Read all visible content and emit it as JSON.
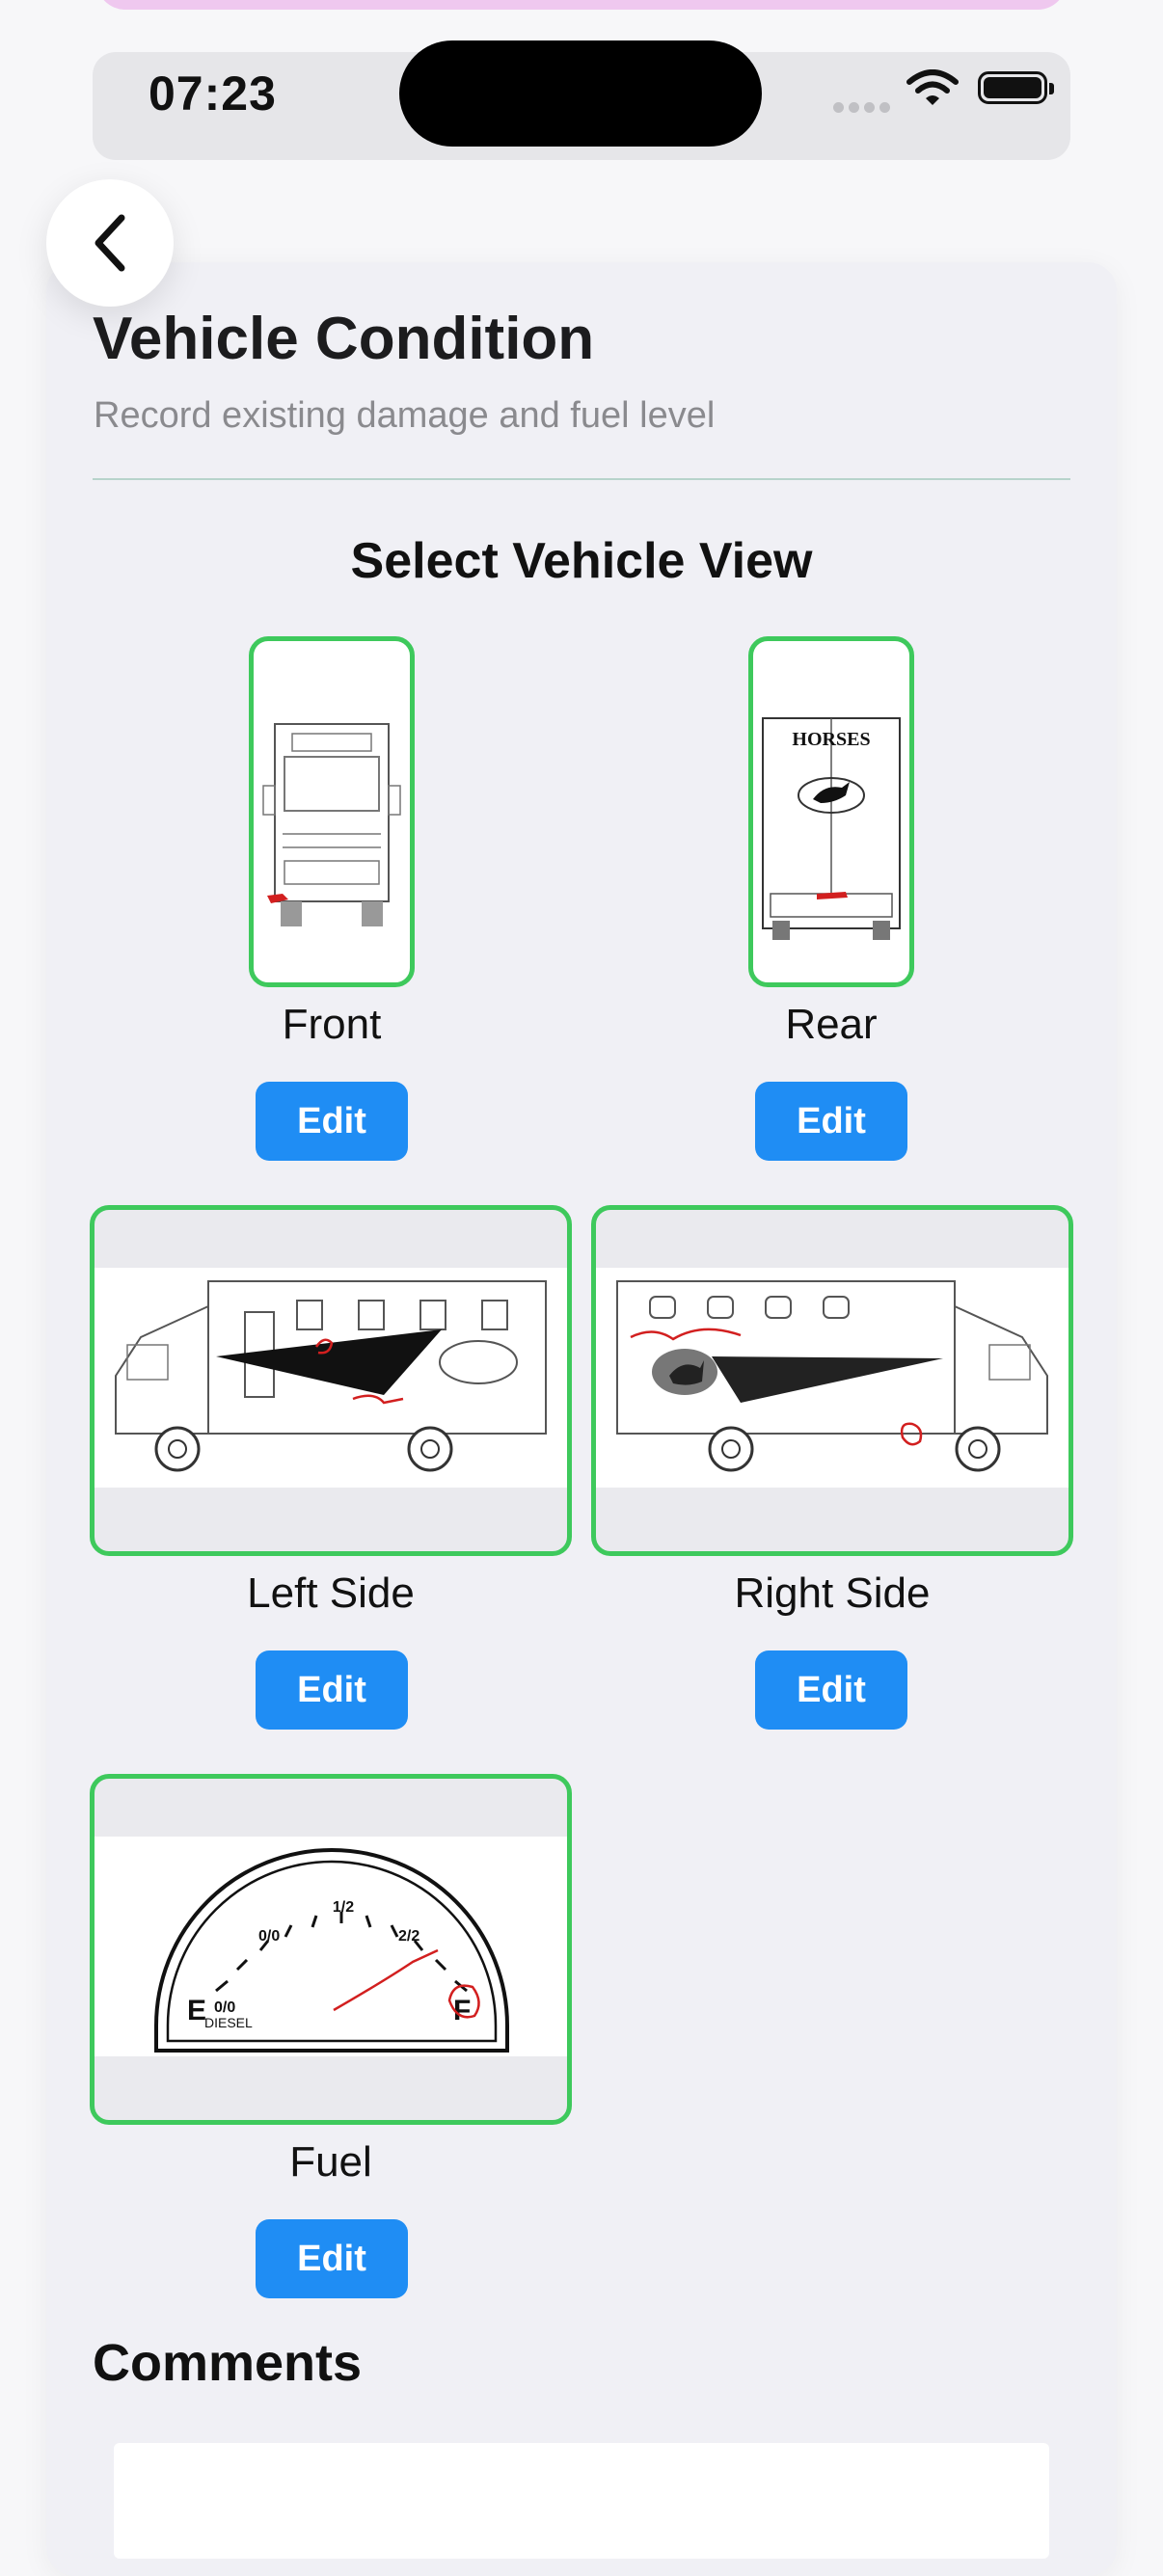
{
  "status_bar": {
    "time": "07:23"
  },
  "header": {
    "title": "Vehicle Condition",
    "subtitle": "Record existing damage and fuel level"
  },
  "views_section": {
    "title": "Select Vehicle View",
    "views": [
      {
        "label": "Front",
        "edit_label": "Edit"
      },
      {
        "label": "Rear",
        "edit_label": "Edit",
        "sign_text": "HORSES"
      },
      {
        "label": "Left Side",
        "edit_label": "Edit"
      },
      {
        "label": "Right Side",
        "edit_label": "Edit"
      },
      {
        "label": "Fuel",
        "edit_label": "Edit",
        "gauge": {
          "tick_0": "0/0",
          "tick_half": "1/2",
          "tick_full": "2/2",
          "empty": "E",
          "empty_value": "0/0",
          "fuel_type": "DIESEL",
          "full": "F"
        }
      }
    ]
  },
  "comments": {
    "title": "Comments",
    "value": ""
  },
  "colors": {
    "accent": "#1f8df4",
    "tile_border": "#3ec95c",
    "annotation": "#d21f1f"
  },
  "icons": {
    "back": "chevron-left-icon",
    "wifi": "wifi-icon",
    "battery": "battery-icon"
  }
}
